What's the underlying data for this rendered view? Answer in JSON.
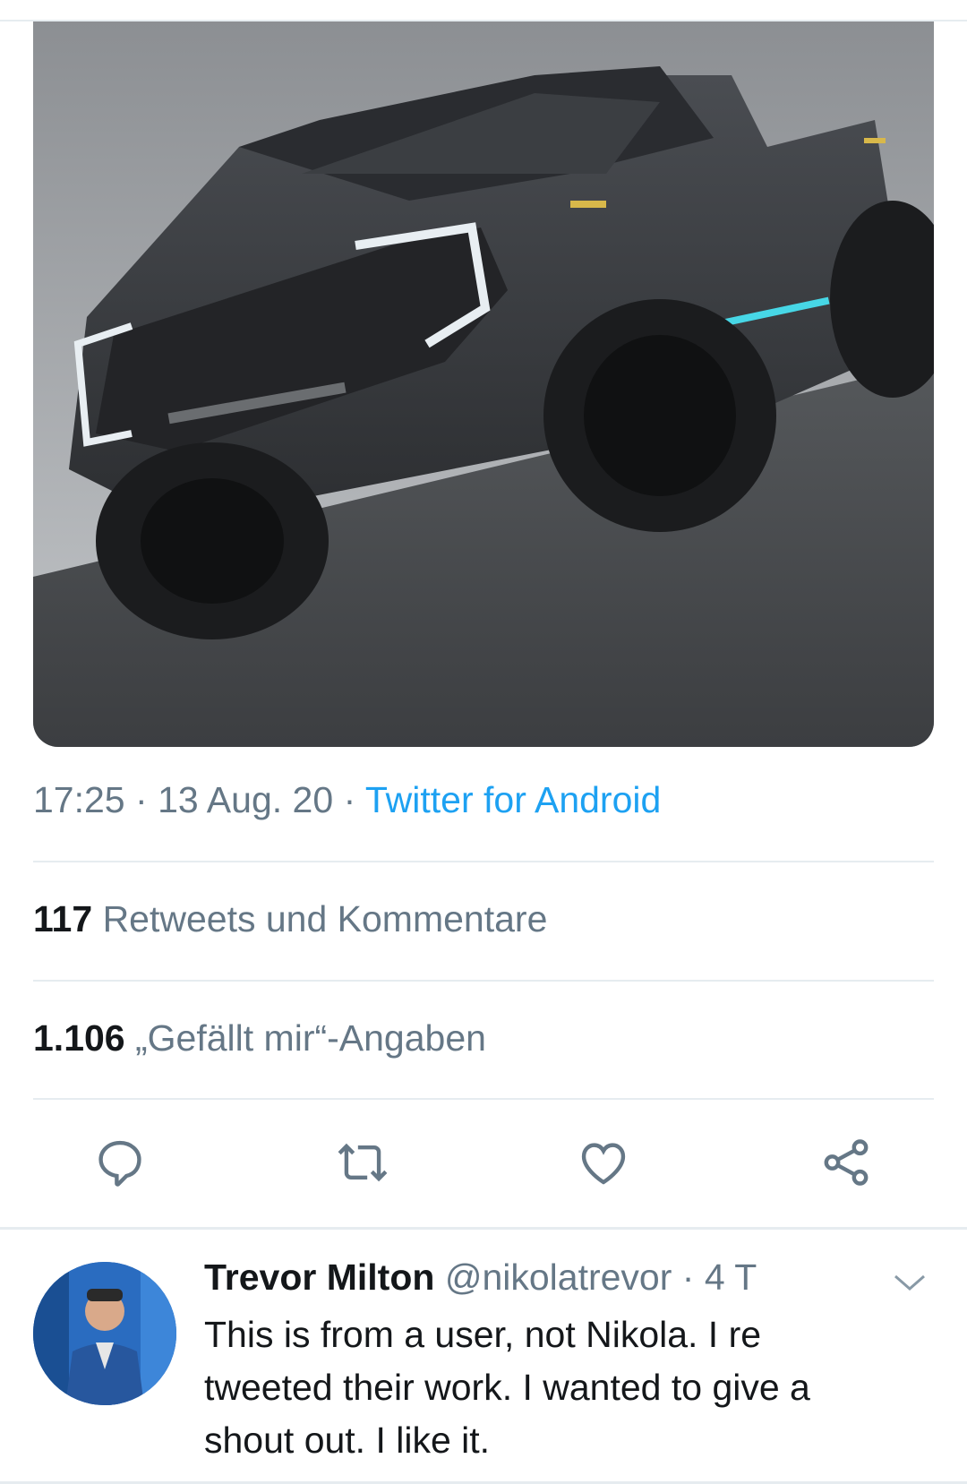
{
  "tweet": {
    "time": "17:25",
    "date": "13 Aug. 20",
    "separator": "·",
    "source": "Twitter for Android"
  },
  "stats": {
    "retweets_count": "117",
    "retweets_label": "Retweets und Kommentare",
    "likes_count": "1.106",
    "likes_label": "„Gefällt mir“-Angaben"
  },
  "actions": {
    "reply_icon": "comment-icon",
    "retweet_icon": "retweet-icon",
    "like_icon": "heart-icon",
    "share_icon": "share-icon"
  },
  "reply": {
    "name": "Trevor Milton",
    "handle": "@nikolatrevor",
    "separator": "·",
    "age": "4 T",
    "text": "This is from a user, not Nikola. I re tweeted their work. I wanted to give a shout out. I like it."
  },
  "colors": {
    "accent": "#1da1f2",
    "secondary_text": "#657786",
    "primary_text": "#14171a",
    "divider": "#e6ecf0"
  }
}
